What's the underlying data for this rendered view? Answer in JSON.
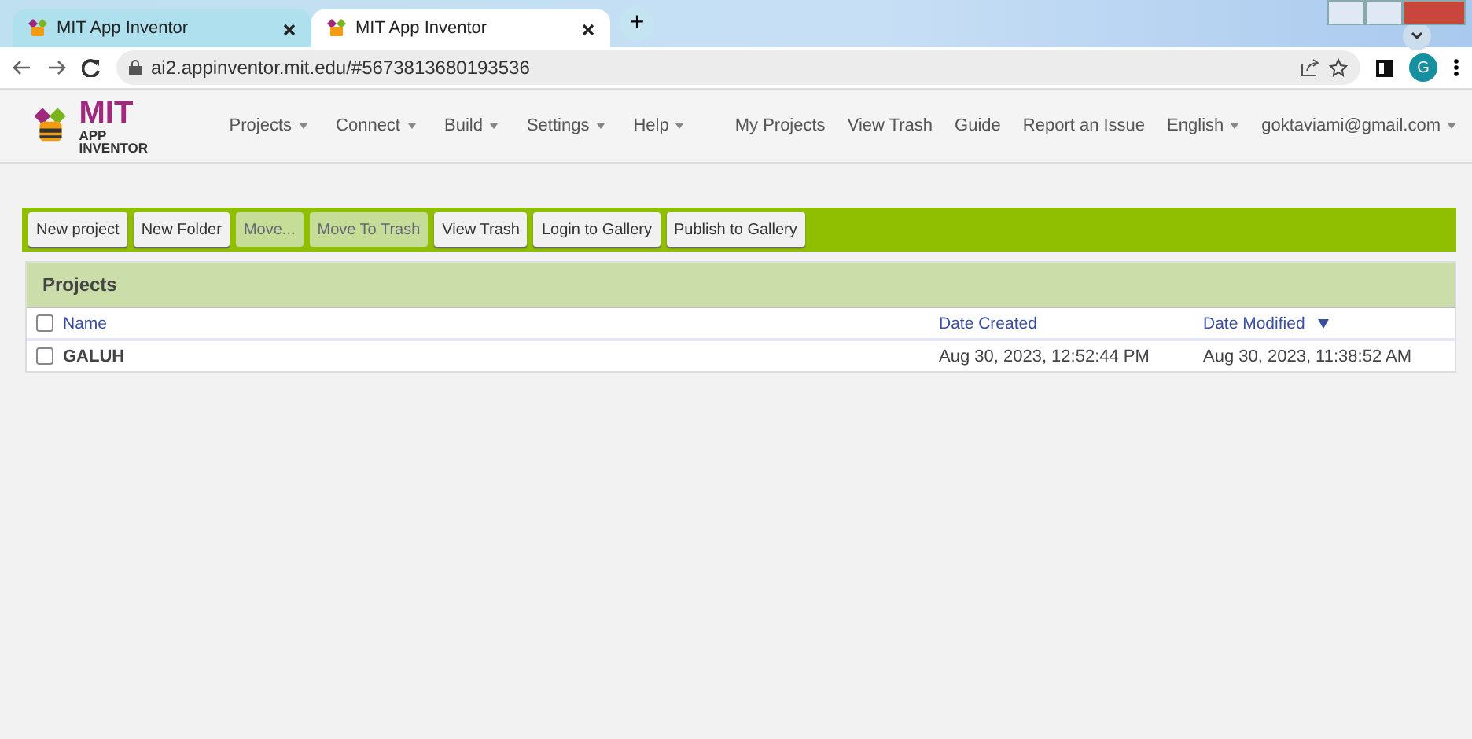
{
  "browser": {
    "tabs": [
      {
        "title": "MIT App Inventor",
        "selected": false
      },
      {
        "title": "MIT App Inventor",
        "selected": true
      }
    ],
    "new_tab": "+",
    "url": "ai2.appinventor.mit.edu/#5673813680193536",
    "avatar": "G"
  },
  "header": {
    "logo_title": "MIT",
    "logo_subtitle": "APP INVENTOR",
    "menus": [
      {
        "label": "Projects",
        "dropdown": true
      },
      {
        "label": "Connect",
        "dropdown": true
      },
      {
        "label": "Build",
        "dropdown": true
      },
      {
        "label": "Settings",
        "dropdown": true
      },
      {
        "label": "Help",
        "dropdown": true
      }
    ],
    "links": [
      {
        "label": "My Projects",
        "dropdown": false
      },
      {
        "label": "View Trash",
        "dropdown": false
      },
      {
        "label": "Guide",
        "dropdown": false
      },
      {
        "label": "Report an Issue",
        "dropdown": false
      },
      {
        "label": "English",
        "dropdown": true
      },
      {
        "label": "goktaviami@gmail.com",
        "dropdown": true
      }
    ]
  },
  "toolbar": [
    {
      "label": "New project",
      "disabled": false
    },
    {
      "label": "New Folder",
      "disabled": false
    },
    {
      "label": "Move...",
      "disabled": true
    },
    {
      "label": "Move To Trash",
      "disabled": true
    },
    {
      "label": "View Trash",
      "disabled": false
    },
    {
      "label": "Login to Gallery",
      "disabled": false
    },
    {
      "label": "Publish to Gallery",
      "disabled": false
    }
  ],
  "projects": {
    "title": "Projects",
    "all_checked": false,
    "columns": [
      {
        "label": "Name",
        "sorted": false
      },
      {
        "label": "Date Created",
        "sorted": false
      },
      {
        "label": "Date Modified",
        "sorted": true
      }
    ],
    "rows": [
      {
        "name": "GALUH",
        "checked": false,
        "created": "Aug 30, 2023, 12:52:44 PM",
        "modified": "Aug 30, 2023, 11:38:52 AM"
      }
    ]
  }
}
